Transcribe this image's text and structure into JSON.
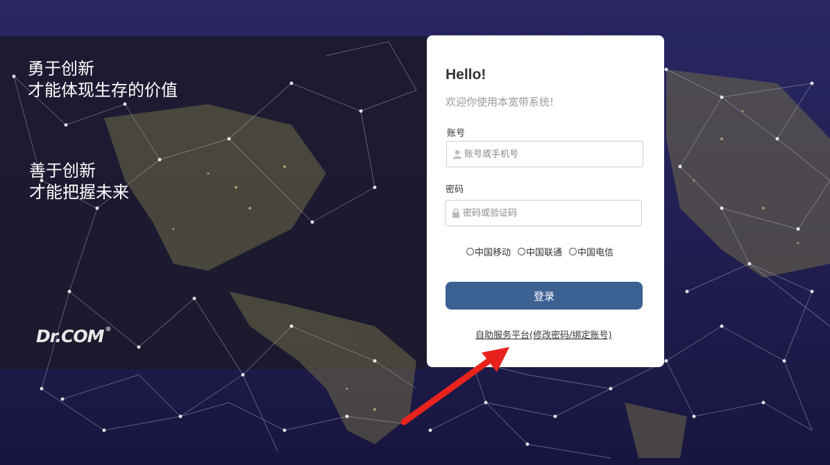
{
  "slogans": {
    "line1": "勇于创新",
    "line2": "才能体现生存的价值",
    "line3": "善于创新",
    "line4": "才能把握未来"
  },
  "logo": {
    "text": "Dr.COM",
    "mark": "®"
  },
  "login": {
    "hello": "Hello!",
    "welcome": "欢迎你使用本宽带系统!",
    "account_label": "账号",
    "account_placeholder": "账号或手机号",
    "account_icon": "user-icon",
    "password_label": "密码",
    "password_placeholder": "密码或验证码",
    "password_icon": "lock-icon",
    "isp_options": [
      "中国移动",
      "中国联通",
      "中国电信"
    ],
    "submit_label": "登录",
    "self_service_link": "自助服务平台(修改密码/绑定账号)"
  },
  "colors": {
    "button": "#3c6193",
    "background": "#1d1b4f",
    "annotation_arrow": "#e8231d"
  }
}
